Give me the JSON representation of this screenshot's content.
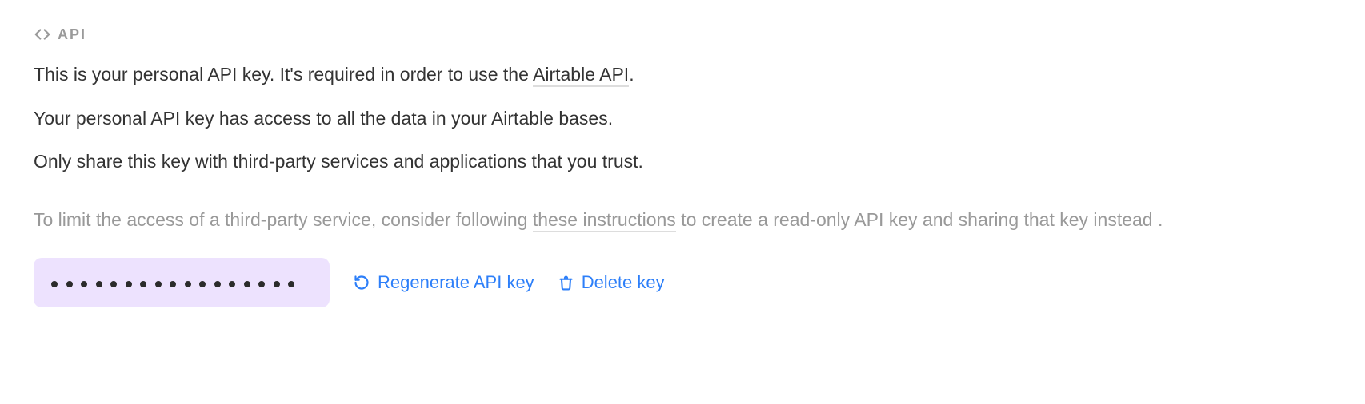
{
  "section": {
    "label": "API"
  },
  "description": {
    "line1_pre": "This is your personal API key. It's required in order to use the ",
    "line1_link": "Airtable API",
    "line1_post": ".",
    "line2": "Your personal API key has access to all the data in your Airtable bases.",
    "line3": "Only share this key with third-party services and applications that you trust.",
    "muted_pre": "To limit the access of a third-party service, consider following ",
    "muted_link": "these instructions",
    "muted_post": " to create a read-only API key and sharing that key instead ."
  },
  "key": {
    "masked_dots": 17
  },
  "actions": {
    "regenerate": "Regenerate API key",
    "delete": "Delete key"
  }
}
